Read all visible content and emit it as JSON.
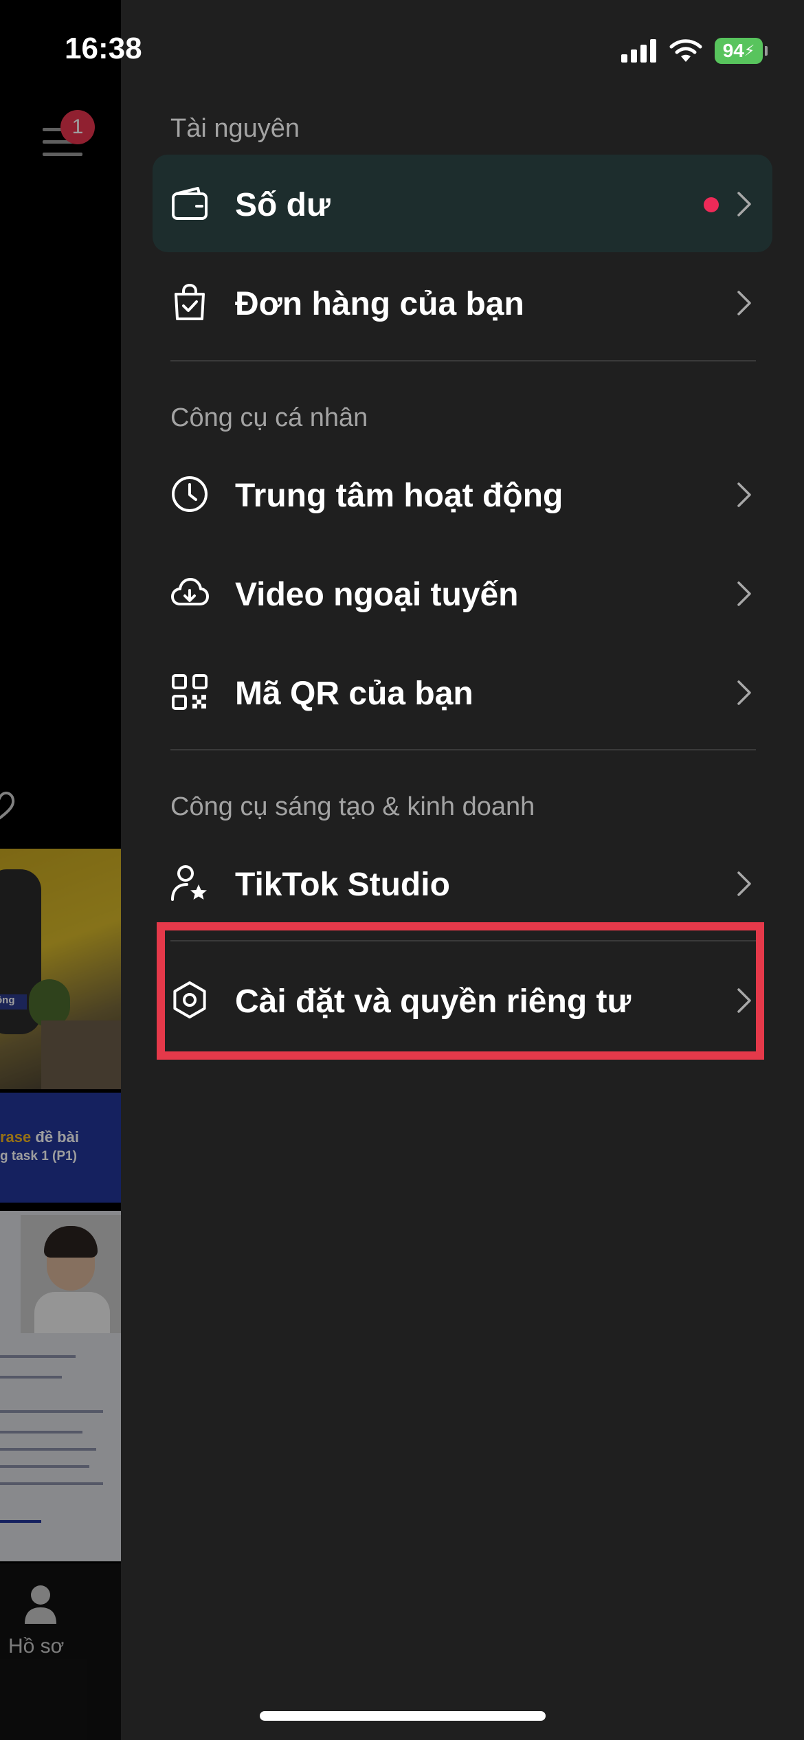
{
  "status_bar": {
    "time": "16:38",
    "battery": "94"
  },
  "background_app": {
    "notification_count": "1",
    "thumb1_tag": "ông",
    "thumb2_line1_highlight": "rase",
    "thumb2_line1_rest": " đề bài",
    "thumb2_line2": "g task 1 (P1)",
    "nav_profile_label": "Hồ sơ"
  },
  "drawer": {
    "sections": [
      {
        "title": "Tài nguyên",
        "items": [
          {
            "label": "Số dư",
            "icon": "wallet-icon",
            "has_dot": true,
            "active": true
          },
          {
            "label": "Đơn hàng của bạn",
            "icon": "shopping-bag-icon"
          }
        ]
      },
      {
        "title": "Công cụ cá nhân",
        "items": [
          {
            "label": "Trung tâm hoạt động",
            "icon": "clock-icon"
          },
          {
            "label": "Video ngoại tuyến",
            "icon": "cloud-download-icon"
          },
          {
            "label": "Mã QR của bạn",
            "icon": "qr-code-icon"
          }
        ]
      },
      {
        "title": "Công cụ sáng tạo & kinh doanh",
        "items": [
          {
            "label": "TikTok Studio",
            "icon": "creator-star-icon"
          },
          {
            "label": "Cài đặt và quyền riêng tư",
            "icon": "settings-gear-icon",
            "highlighted": true
          }
        ]
      }
    ]
  },
  "colors": {
    "drawer_bg": "#1f1f1f",
    "active_item_bg": "#1d2d2d",
    "dot": "#ee2a58",
    "highlight_border": "#e5394a"
  }
}
